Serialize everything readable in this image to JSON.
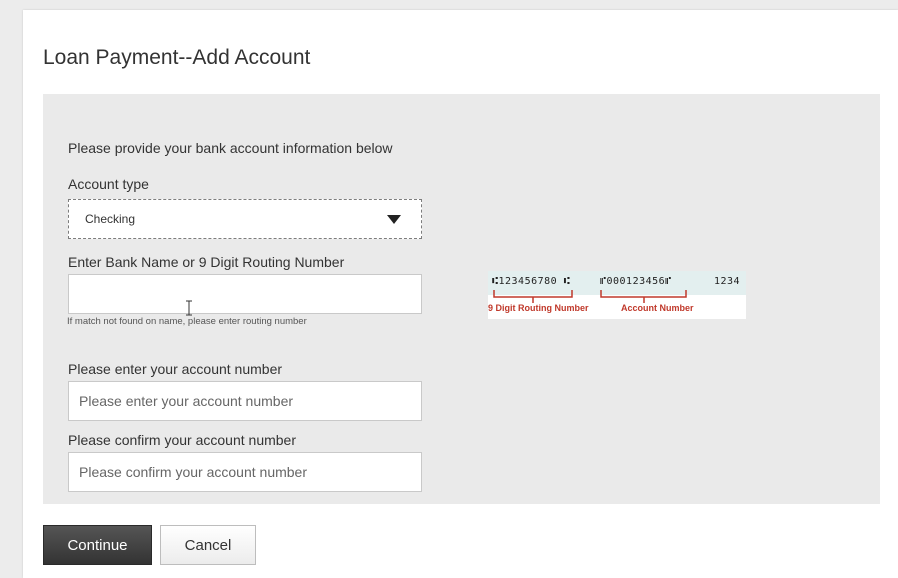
{
  "page": {
    "title": "Loan Payment--Add Account"
  },
  "form": {
    "instructions": "Please provide your bank account information below",
    "account_type": {
      "label": "Account type",
      "selected": "Checking"
    },
    "bank": {
      "label": "Enter Bank Name or 9 Digit Routing Number",
      "value": "",
      "placeholder": "",
      "hint": "If match not found on name, please enter routing number"
    },
    "account_number": {
      "label": "Please enter your account number",
      "placeholder": "Please enter your account number"
    },
    "confirm_account_number": {
      "label": "Please confirm your account number",
      "placeholder": "Please confirm your account number"
    }
  },
  "check_sample": {
    "routing_micr": "⑆123456780 ⑆",
    "account_micr": "⑈000123456⑈",
    "check_micr": "1234",
    "routing_caption": "9 Digit Routing Number",
    "account_caption": "Account Number",
    "caption_color": "#c0392b"
  },
  "actions": {
    "continue_label": "Continue",
    "cancel_label": "Cancel"
  },
  "icons": {
    "dropdown": "chevron-down-icon",
    "text_cursor": "i-beam-cursor-icon"
  }
}
